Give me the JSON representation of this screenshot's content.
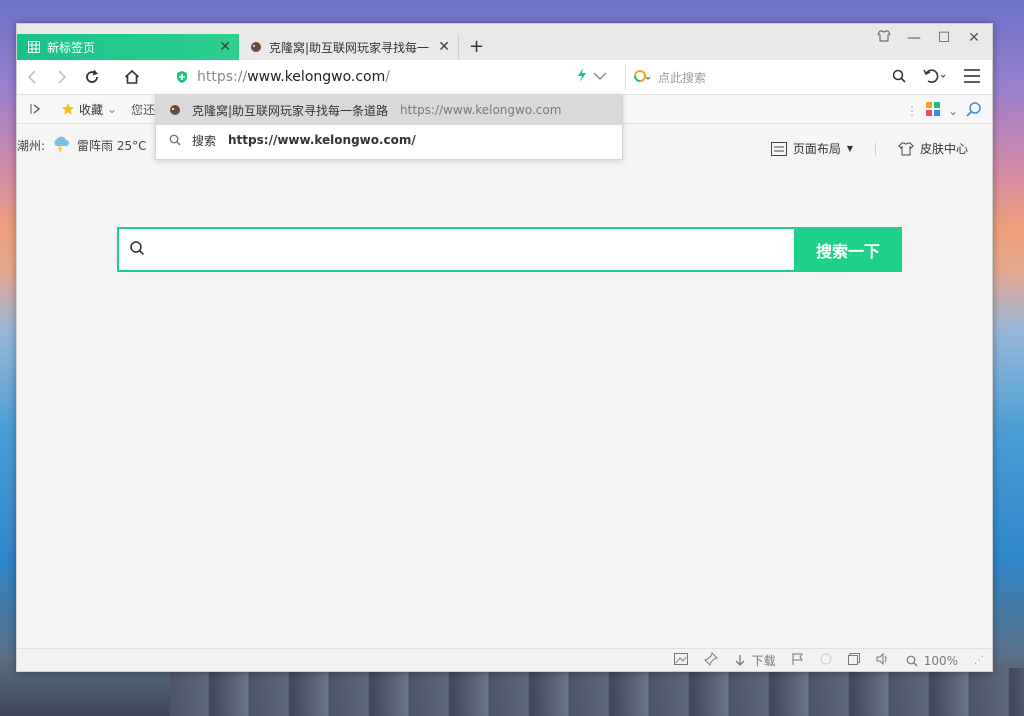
{
  "window": {
    "title": "新标签页"
  },
  "tabs": [
    {
      "title": "新标签页",
      "close": "✕"
    },
    {
      "title": "克隆窝|助互联网玩家寻找每一条",
      "close": "✕"
    }
  ],
  "toolbar": {
    "url_prefix": "https://",
    "url_host": "www.kelongwo.com",
    "url_suffix": "/",
    "search_placeholder": "点此搜索"
  },
  "bookmarks": {
    "favorites_label": "收藏",
    "hint_text": "您还"
  },
  "dropdown": {
    "items": [
      {
        "title": "克隆窝|助互联网玩家寻找每一条道路",
        "url": "https://www.kelongwo.com"
      },
      {
        "title": "搜索",
        "query": "https://www.kelongwo.com/"
      }
    ]
  },
  "weather": {
    "city": "潮州:",
    "desc": "雷阵雨 25°C"
  },
  "page_tools": {
    "layout_label": "页面布局",
    "skin_label": "皮肤中心"
  },
  "main_search": {
    "button_label": "搜索一下",
    "input_value": ""
  },
  "status": {
    "download_label": "下载",
    "zoom": "100%"
  },
  "colors": {
    "accent": "#1ed089"
  }
}
